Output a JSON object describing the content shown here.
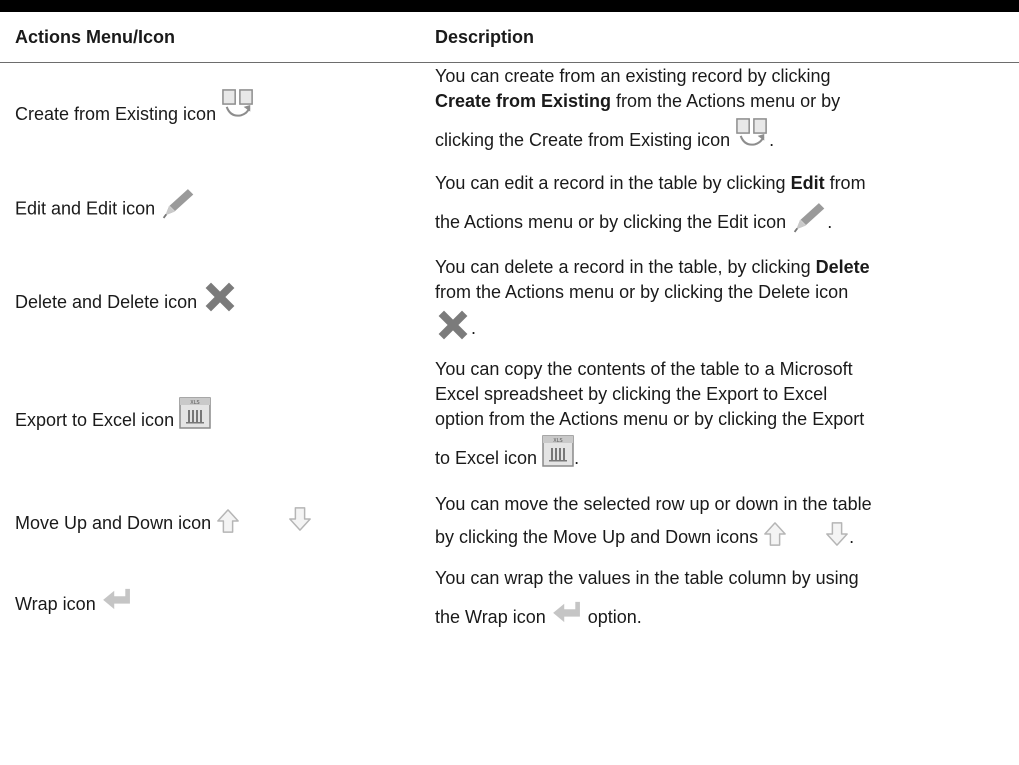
{
  "table": {
    "headers": {
      "col1": "Actions Menu/Icon",
      "col2": "Description"
    },
    "rows": [
      {
        "action": "Create from Existing icon",
        "icon": "create-from-existing-icon",
        "desc": {
          "l1": "You can create from an existing record by clicking",
          "l2_bold": "Create from Existing",
          "l2_rest": " from the Actions menu or by",
          "l3": "clicking the Create from Existing icon ",
          "end": "."
        }
      },
      {
        "action": "Edit and Edit icon",
        "icon": "pencil-icon",
        "desc": {
          "l1_pre": "You can edit a record in the table by clicking ",
          "l1_bold": "Edit",
          "l1_post": " from",
          "l2": "the Actions menu or by clicking the Edit icon ",
          "end": "."
        }
      },
      {
        "action": "Delete and Delete icon",
        "icon": "delete-x-icon",
        "desc": {
          "l1_pre": "You can delete a record in the table, by clicking ",
          "l1_bold": "Delete",
          "l2": "from the Actions menu or by clicking the Delete icon",
          "end": "."
        }
      },
      {
        "action": "Export to Excel icon",
        "icon": "excel-icon",
        "desc": {
          "l1": "You can copy the contents of the table to a Microsoft",
          "l2": "Excel spreadsheet by clicking the Export to Excel",
          "l3": "option from the Actions menu or by clicking the Export",
          "l4": "to Excel icon ",
          "end": "."
        }
      },
      {
        "action": "Move Up and Down icon",
        "icon": "arrow-up-down-icon",
        "desc": {
          "l1": "You can move the selected row up or down in the table",
          "l2": "by clicking the Move Up and Down icons ",
          "end": "."
        }
      },
      {
        "action": "Wrap icon",
        "icon": "wrap-icon",
        "desc": {
          "l1": "You can wrap the values in the table column by using",
          "l2": "the Wrap icon ",
          "end": " option."
        }
      }
    ]
  }
}
